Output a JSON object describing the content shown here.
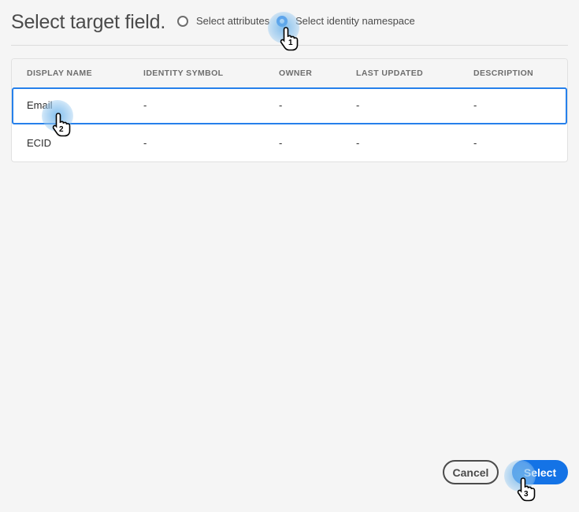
{
  "header": {
    "title": "Select target field.",
    "radio_attributes": "Select attributes",
    "radio_namespace": "Select identity namespace"
  },
  "table": {
    "columns": [
      "DISPLAY NAME",
      "IDENTITY SYMBOL",
      "OWNER",
      "LAST UPDATED",
      "DESCRIPTION"
    ],
    "rows": [
      [
        "Email",
        "-",
        "-",
        "-",
        "-"
      ],
      [
        "ECID",
        "-",
        "-",
        "-",
        "-"
      ]
    ]
  },
  "footer": {
    "cancel_label": "Cancel",
    "select_label": "Select"
  },
  "steps": [
    "1",
    "2",
    "3"
  ],
  "colors": {
    "accent": "#1473e6",
    "selection_border": "#2680eb"
  }
}
